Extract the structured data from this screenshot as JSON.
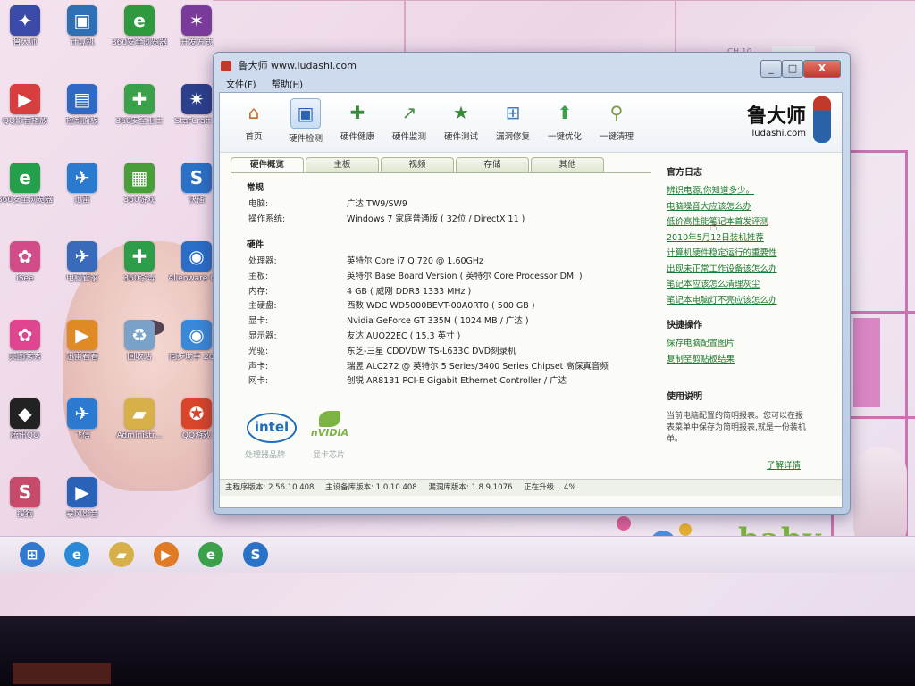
{
  "desktop": {
    "icons": [
      {
        "label": "鲁大师",
        "icon": "robot-icon",
        "color": "#3a4aa8"
      },
      {
        "label": "计算机",
        "icon": "computer-icon",
        "color": "#2f6fb3"
      },
      {
        "label": "360安全浏览器",
        "icon": "ie-icon",
        "color": "#2e9a3d"
      },
      {
        "label": "开发方式",
        "icon": "game-icon",
        "color": "#7a3a9a"
      },
      {
        "label": "QQ影音播放",
        "icon": "media-player-icon",
        "color": "#d83e3e"
      },
      {
        "label": "控制面板",
        "icon": "control-panel-icon",
        "color": "#2f69c4"
      },
      {
        "label": "360安全卫士",
        "icon": "shield-icon",
        "color": "#3aa04a"
      },
      {
        "label": "StarCraft II",
        "icon": "starcraft-icon",
        "color": "#2c3f8c"
      },
      {
        "label": "360安全浏览器",
        "icon": "ie-icon",
        "color": "#25a04a"
      },
      {
        "label": "迅雷",
        "icon": "thunder-icon",
        "color": "#2a7ad0"
      },
      {
        "label": "360游戏",
        "icon": "game-box-icon",
        "color": "#4a9e3a"
      },
      {
        "label": "快播",
        "icon": "qvod-icon",
        "color": "#2a72c8"
      },
      {
        "label": "iSee",
        "icon": "isee-icon",
        "color": "#d44b8a"
      },
      {
        "label": "电脑管家",
        "icon": "bird-icon",
        "color": "#3a6bbb"
      },
      {
        "label": "360杀毒",
        "icon": "shield-icon",
        "color": "#2e9d4a"
      },
      {
        "label": "Alienware Comma...",
        "icon": "globe-icon",
        "color": "#2a6ec8"
      },
      {
        "label": "美图秀秀",
        "icon": "meitu-icon",
        "color": "#e0458f"
      },
      {
        "label": "迅雷看看",
        "icon": "xunlei-kankan-icon",
        "color": "#e08a25"
      },
      {
        "label": "回收站",
        "icon": "recycle-bin-icon",
        "color": "#7aa2c8"
      },
      {
        "label": "同步助手 2010",
        "icon": "globe-icon",
        "color": "#3a88d8"
      },
      {
        "label": "腾讯QQ",
        "icon": "qq-penguin-icon",
        "color": "#222222"
      },
      {
        "label": "飞信",
        "icon": "fetion-icon",
        "color": "#2c7ad0"
      },
      {
        "label": "Administr...",
        "icon": "user-folder-icon",
        "color": "#d8b04a"
      },
      {
        "label": "QQ游戏",
        "icon": "qq-game-icon",
        "color": "#d8452a"
      },
      {
        "label": "搜狗",
        "icon": "sogou-icon",
        "color": "#c84a6a"
      },
      {
        "label": "暴风影音",
        "icon": "video-icon",
        "color": "#2a62b8"
      }
    ],
    "wallpaper_text": "baby",
    "tray_text": "CH 10"
  },
  "taskbar": {
    "buttons": [
      {
        "icon": "windows-start-icon",
        "color": "#2f7ad0"
      },
      {
        "icon": "ie-icon",
        "color": "#2a8ad8"
      },
      {
        "icon": "folder-icon",
        "color": "#d8b04a"
      },
      {
        "icon": "media-player-icon",
        "color": "#e07a25"
      },
      {
        "icon": "360-browser-icon",
        "color": "#3aa04a"
      },
      {
        "icon": "sogou-icon",
        "color": "#2a72c8"
      }
    ]
  },
  "window": {
    "title": "鲁大师 www.ludashi.com",
    "menu": [
      "文件(F)",
      "帮助(H)"
    ],
    "controls": {
      "minimize": "_",
      "maximize": "□",
      "close": "X"
    },
    "toolbar": [
      {
        "label": "首页",
        "icon": "home-icon"
      },
      {
        "label": "硬件检测",
        "icon": "monitor-icon"
      },
      {
        "label": "硬件健康",
        "icon": "health-icon"
      },
      {
        "label": "硬件监测",
        "icon": "chart-monitor-icon"
      },
      {
        "label": "硬件测试",
        "icon": "star-icon"
      },
      {
        "label": "漏洞修复",
        "icon": "windows-flag-icon"
      },
      {
        "label": "一键优化",
        "icon": "arrow-up-icon"
      },
      {
        "label": "一键清理",
        "icon": "broom-icon"
      }
    ],
    "brand": {
      "name": "鲁大师",
      "url": "ludashi.com"
    },
    "tabs": [
      "硬件概览",
      "主板",
      "视频",
      "存储",
      "其他"
    ],
    "overview": {
      "general_title": "常规",
      "general": [
        {
          "key": "电脑:",
          "value": "广达 TW9/SW9"
        },
        {
          "key": "操作系统:",
          "value": "Windows 7 家庭普通版 ( 32位 / DirectX 11 )"
        }
      ],
      "hardware_title": "硬件",
      "hardware": [
        {
          "key": "处理器:",
          "value": "英特尔 Core i7 Q 720 @ 1.60GHz"
        },
        {
          "key": "主板:",
          "value": "英特尔 Base Board Version ( 英特尔 Core Processor DMI )"
        },
        {
          "key": "内存:",
          "value": "4 GB ( 威刚 DDR3 1333 MHz )"
        },
        {
          "key": "主硬盘:",
          "value": "西数 WDC WD5000BEVT-00A0RT0 ( 500 GB )"
        },
        {
          "key": "显卡:",
          "value": "Nvidia GeForce GT 335M ( 1024 MB / 广达 )"
        },
        {
          "key": "显示器:",
          "value": "友达 AUO22EC ( 15.3 英寸 )"
        },
        {
          "key": "光驱:",
          "value": "东芝-三星 CDDVDW TS-L633C DVD刻录机"
        },
        {
          "key": "声卡:",
          "value": "瑞昱 ALC272 @ 英特尔 5 Series/3400 Series Chipset 高保真音频"
        },
        {
          "key": "网卡:",
          "value": "创锐 AR8131 PCI-E Gigabit Ethernet Controller / 广达"
        }
      ]
    },
    "logos": {
      "intel": "intel",
      "intel_caption": "处理器品牌",
      "nvidia": "nVIDIA",
      "nvidia_caption": "显卡芯片"
    },
    "sidebar": {
      "log_title": "官方日志",
      "log_links": [
        "辨识电源,你知道多少。",
        "电脑噪音大应该怎么办",
        "低价高性能笔记本首发评测",
        "2010年5月12日装机推荐",
        "计算机硬件稳定运行的重要性",
        "出现未正常工作设备该怎么办",
        "笔记本应该怎么清理灰尘",
        "笔记本电脑灯不亮应该怎么办"
      ],
      "quick_title": "快捷操作",
      "quick_links": [
        "保存电脑配置图片",
        "复制至剪贴板结果"
      ],
      "help_title": "使用说明",
      "help_text": "当前电脑配置的简明报表。您可以在报表菜单中保存为简明报表,就是一份装机单。",
      "help_link": "了解详情"
    },
    "status": {
      "main_version": "主程序版本: 2.56.10.408",
      "device_lib": "主设备库版本: 1.0.10.408",
      "patch_lib": "漏洞库版本: 1.8.9.1076",
      "upgrading": "正在升级... 4%"
    }
  }
}
